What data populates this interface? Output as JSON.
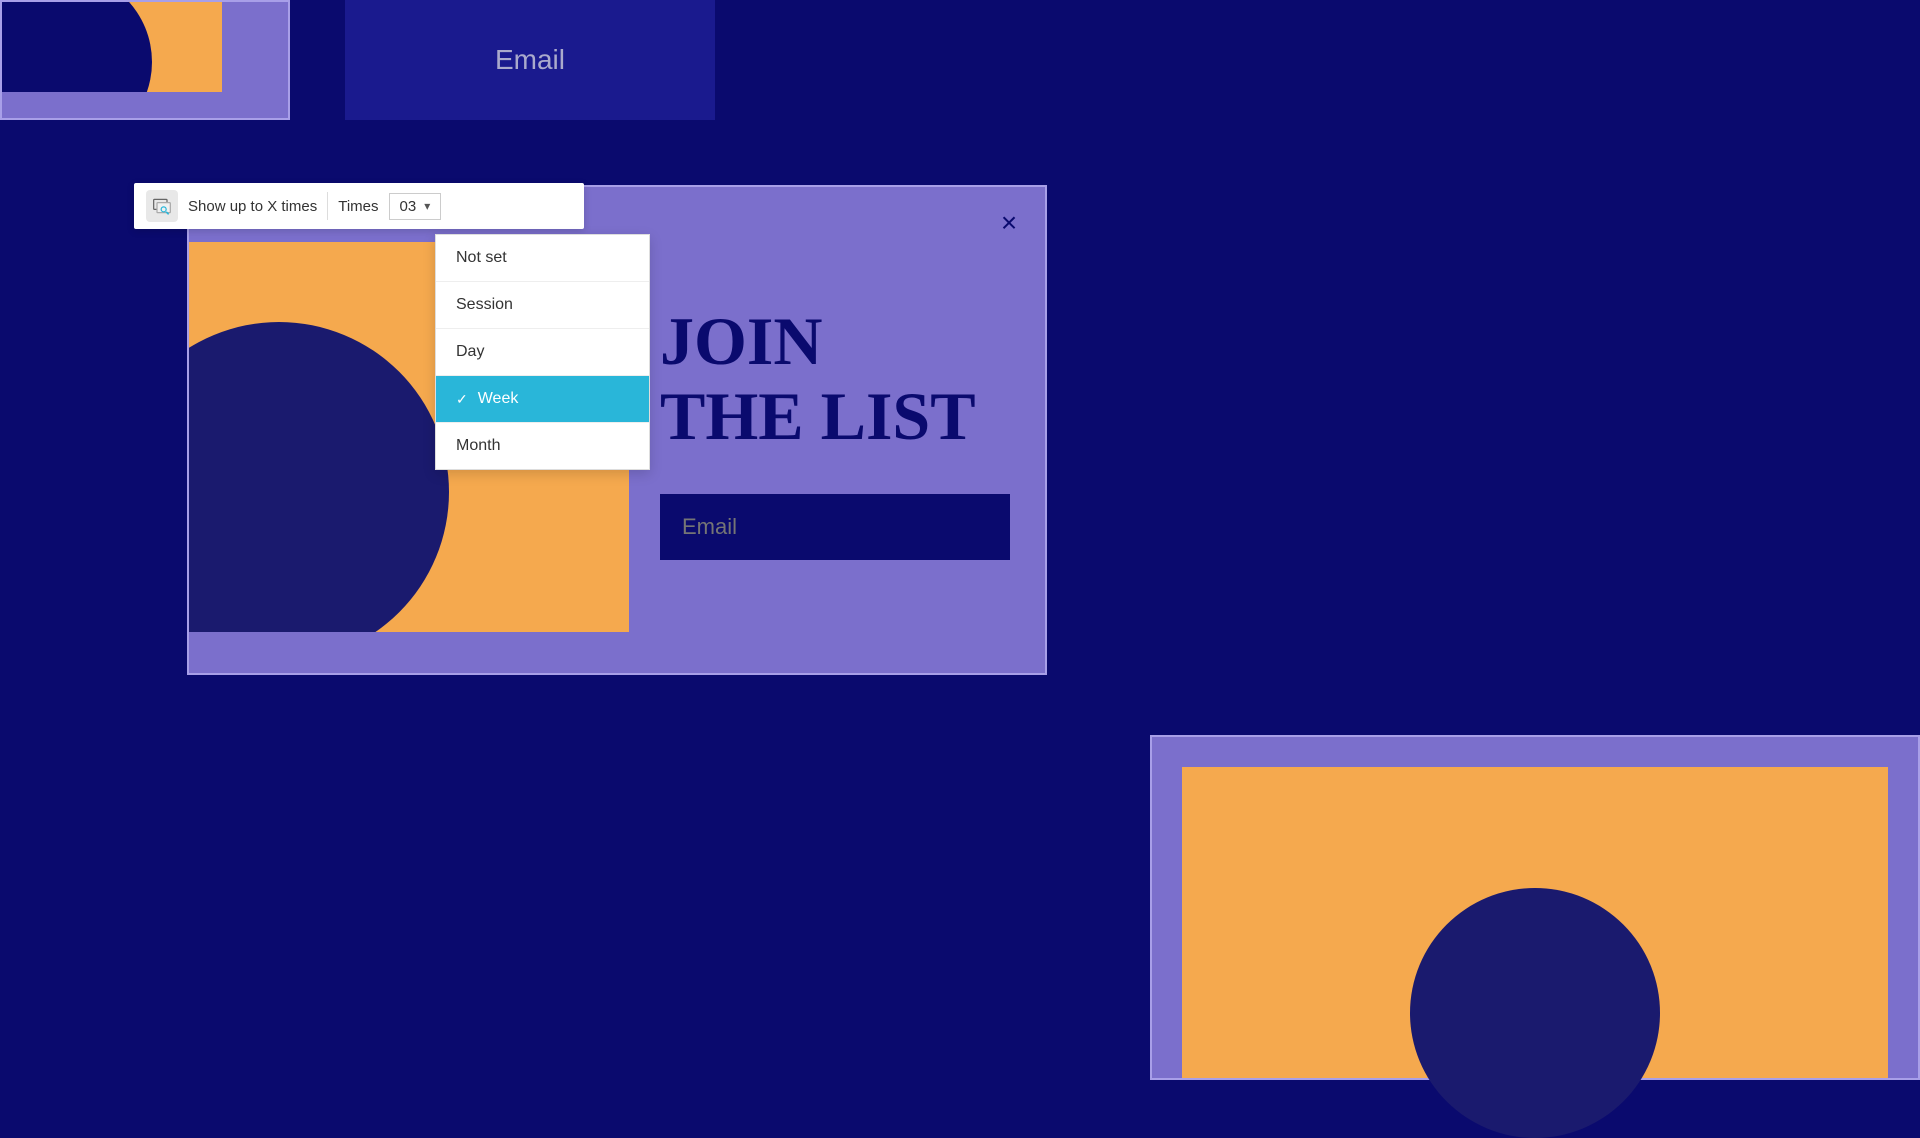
{
  "background_color": "#0a0a6e",
  "toolbar": {
    "icon_label": "popup-icon",
    "show_label": "Show up to X times",
    "times_label": "Times",
    "value": "03",
    "chevron": "▾"
  },
  "dropdown": {
    "items": [
      {
        "label": "Not set",
        "selected": false
      },
      {
        "label": "Session",
        "selected": false
      },
      {
        "label": "Day",
        "selected": false
      },
      {
        "label": "Week",
        "selected": true
      },
      {
        "label": "Month",
        "selected": false
      }
    ]
  },
  "modal": {
    "title_line1": "JOIN",
    "title_line2": "THE LIST",
    "email_placeholder": "Email",
    "close_label": "×"
  },
  "top_email": {
    "label": "Email"
  }
}
